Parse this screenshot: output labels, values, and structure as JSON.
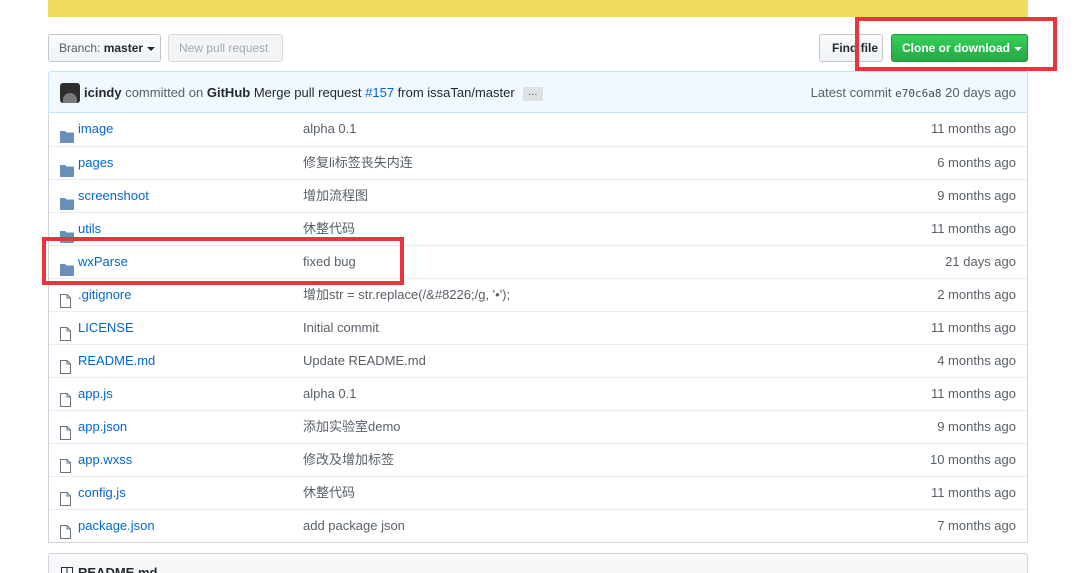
{
  "toolbar": {
    "branch_prefix": "Branch:",
    "branch_name": "master",
    "new_pr_label": "New pull request",
    "find_file_label": "Find file",
    "clone_label": "Clone or download"
  },
  "commit": {
    "author": "icindy",
    "committed_on": "committed on",
    "platform": "GitHub",
    "message_prefix": "Merge pull request",
    "pr_number": "#157",
    "message_suffix": "from issaTan/master",
    "ellipsis": "…",
    "latest_label": "Latest commit",
    "sha": "e70c6a8",
    "age": "20 days ago"
  },
  "files": [
    {
      "type": "dir",
      "name": "image",
      "message": "alpha 0.1",
      "age": "11 months ago"
    },
    {
      "type": "dir",
      "name": "pages",
      "message": "修复li标签丧失内连",
      "age": "6 months ago"
    },
    {
      "type": "dir",
      "name": "screenshoot",
      "message": "增加流程图",
      "age": "9 months ago"
    },
    {
      "type": "dir",
      "name": "utils",
      "message": "休整代码",
      "age": "11 months ago"
    },
    {
      "type": "dir",
      "name": "wxParse",
      "message": "fixed bug",
      "age": "21 days ago"
    },
    {
      "type": "file",
      "name": ".gitignore",
      "message": "增加str = str.replace(/&#8226;/g, '•');",
      "age": "2 months ago"
    },
    {
      "type": "file",
      "name": "LICENSE",
      "message": "Initial commit",
      "age": "11 months ago"
    },
    {
      "type": "file",
      "name": "README.md",
      "message": "Update README.md",
      "age": "4 months ago"
    },
    {
      "type": "file",
      "name": "app.js",
      "message": "alpha 0.1",
      "age": "11 months ago"
    },
    {
      "type": "file",
      "name": "app.json",
      "message": "添加实验室demo",
      "age": "9 months ago"
    },
    {
      "type": "file",
      "name": "app.wxss",
      "message": "修改及增加标签",
      "age": "10 months ago"
    },
    {
      "type": "file",
      "name": "config.js",
      "message": "休整代码",
      "age": "11 months ago"
    },
    {
      "type": "file",
      "name": "package.json",
      "message": "add package json",
      "age": "7 months ago"
    }
  ],
  "readme": {
    "title": "README.md"
  },
  "colors": {
    "banner": "#f1db5f",
    "highlight": "#e8343a",
    "clone_button": "#28a745",
    "link": "#0366d6"
  }
}
